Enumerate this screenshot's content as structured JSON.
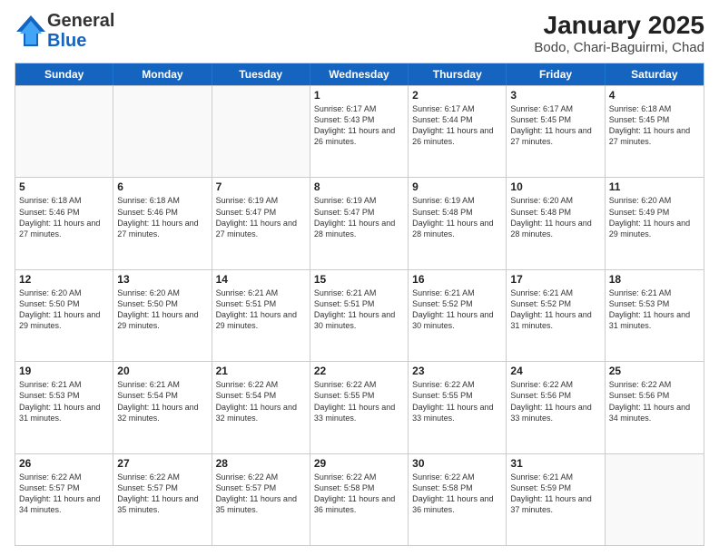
{
  "header": {
    "logo_general": "General",
    "logo_blue": "Blue",
    "title": "January 2025",
    "subtitle": "Bodo, Chari-Baguirmi, Chad"
  },
  "days": [
    "Sunday",
    "Monday",
    "Tuesday",
    "Wednesday",
    "Thursday",
    "Friday",
    "Saturday"
  ],
  "weeks": [
    [
      {
        "day": "",
        "info": ""
      },
      {
        "day": "",
        "info": ""
      },
      {
        "day": "",
        "info": ""
      },
      {
        "day": "1",
        "info": "Sunrise: 6:17 AM\nSunset: 5:43 PM\nDaylight: 11 hours and 26 minutes."
      },
      {
        "day": "2",
        "info": "Sunrise: 6:17 AM\nSunset: 5:44 PM\nDaylight: 11 hours and 26 minutes."
      },
      {
        "day": "3",
        "info": "Sunrise: 6:17 AM\nSunset: 5:45 PM\nDaylight: 11 hours and 27 minutes."
      },
      {
        "day": "4",
        "info": "Sunrise: 6:18 AM\nSunset: 5:45 PM\nDaylight: 11 hours and 27 minutes."
      }
    ],
    [
      {
        "day": "5",
        "info": "Sunrise: 6:18 AM\nSunset: 5:46 PM\nDaylight: 11 hours and 27 minutes."
      },
      {
        "day": "6",
        "info": "Sunrise: 6:18 AM\nSunset: 5:46 PM\nDaylight: 11 hours and 27 minutes."
      },
      {
        "day": "7",
        "info": "Sunrise: 6:19 AM\nSunset: 5:47 PM\nDaylight: 11 hours and 27 minutes."
      },
      {
        "day": "8",
        "info": "Sunrise: 6:19 AM\nSunset: 5:47 PM\nDaylight: 11 hours and 28 minutes."
      },
      {
        "day": "9",
        "info": "Sunrise: 6:19 AM\nSunset: 5:48 PM\nDaylight: 11 hours and 28 minutes."
      },
      {
        "day": "10",
        "info": "Sunrise: 6:20 AM\nSunset: 5:48 PM\nDaylight: 11 hours and 28 minutes."
      },
      {
        "day": "11",
        "info": "Sunrise: 6:20 AM\nSunset: 5:49 PM\nDaylight: 11 hours and 29 minutes."
      }
    ],
    [
      {
        "day": "12",
        "info": "Sunrise: 6:20 AM\nSunset: 5:50 PM\nDaylight: 11 hours and 29 minutes."
      },
      {
        "day": "13",
        "info": "Sunrise: 6:20 AM\nSunset: 5:50 PM\nDaylight: 11 hours and 29 minutes."
      },
      {
        "day": "14",
        "info": "Sunrise: 6:21 AM\nSunset: 5:51 PM\nDaylight: 11 hours and 29 minutes."
      },
      {
        "day": "15",
        "info": "Sunrise: 6:21 AM\nSunset: 5:51 PM\nDaylight: 11 hours and 30 minutes."
      },
      {
        "day": "16",
        "info": "Sunrise: 6:21 AM\nSunset: 5:52 PM\nDaylight: 11 hours and 30 minutes."
      },
      {
        "day": "17",
        "info": "Sunrise: 6:21 AM\nSunset: 5:52 PM\nDaylight: 11 hours and 31 minutes."
      },
      {
        "day": "18",
        "info": "Sunrise: 6:21 AM\nSunset: 5:53 PM\nDaylight: 11 hours and 31 minutes."
      }
    ],
    [
      {
        "day": "19",
        "info": "Sunrise: 6:21 AM\nSunset: 5:53 PM\nDaylight: 11 hours and 31 minutes."
      },
      {
        "day": "20",
        "info": "Sunrise: 6:21 AM\nSunset: 5:54 PM\nDaylight: 11 hours and 32 minutes."
      },
      {
        "day": "21",
        "info": "Sunrise: 6:22 AM\nSunset: 5:54 PM\nDaylight: 11 hours and 32 minutes."
      },
      {
        "day": "22",
        "info": "Sunrise: 6:22 AM\nSunset: 5:55 PM\nDaylight: 11 hours and 33 minutes."
      },
      {
        "day": "23",
        "info": "Sunrise: 6:22 AM\nSunset: 5:55 PM\nDaylight: 11 hours and 33 minutes."
      },
      {
        "day": "24",
        "info": "Sunrise: 6:22 AM\nSunset: 5:56 PM\nDaylight: 11 hours and 33 minutes."
      },
      {
        "day": "25",
        "info": "Sunrise: 6:22 AM\nSunset: 5:56 PM\nDaylight: 11 hours and 34 minutes."
      }
    ],
    [
      {
        "day": "26",
        "info": "Sunrise: 6:22 AM\nSunset: 5:57 PM\nDaylight: 11 hours and 34 minutes."
      },
      {
        "day": "27",
        "info": "Sunrise: 6:22 AM\nSunset: 5:57 PM\nDaylight: 11 hours and 35 minutes."
      },
      {
        "day": "28",
        "info": "Sunrise: 6:22 AM\nSunset: 5:57 PM\nDaylight: 11 hours and 35 minutes."
      },
      {
        "day": "29",
        "info": "Sunrise: 6:22 AM\nSunset: 5:58 PM\nDaylight: 11 hours and 36 minutes."
      },
      {
        "day": "30",
        "info": "Sunrise: 6:22 AM\nSunset: 5:58 PM\nDaylight: 11 hours and 36 minutes."
      },
      {
        "day": "31",
        "info": "Sunrise: 6:21 AM\nSunset: 5:59 PM\nDaylight: 11 hours and 37 minutes."
      },
      {
        "day": "",
        "info": ""
      }
    ]
  ]
}
